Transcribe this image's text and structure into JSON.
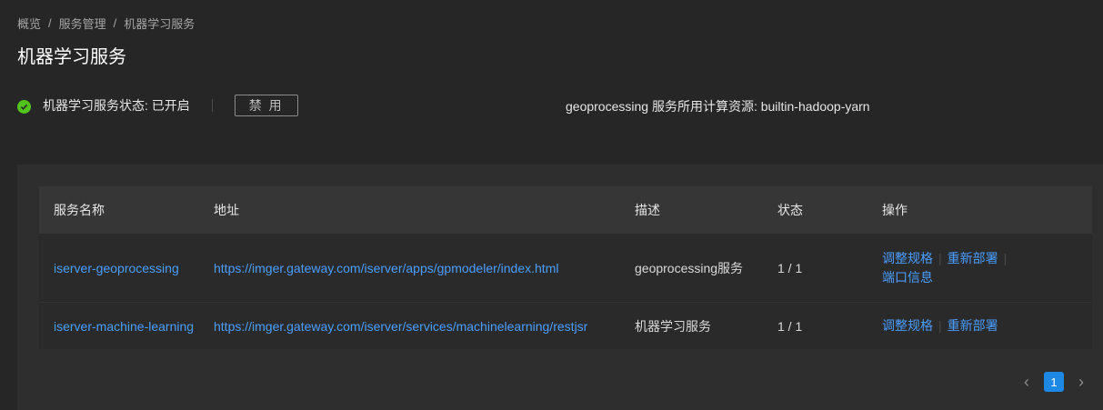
{
  "breadcrumb": {
    "items": [
      "概览",
      "服务管理",
      "机器学习服务"
    ],
    "separator": "/"
  },
  "page": {
    "title": "机器学习服务"
  },
  "status": {
    "text": "机器学习服务状态: 已开启",
    "icon": "check-circle-icon",
    "icon_color": "#52c41a",
    "disable_button": "禁 用",
    "compute_resource": "geoprocessing 服务所用计算资源: builtin-hadoop-yarn"
  },
  "table": {
    "columns": [
      "服务名称",
      "地址",
      "描述",
      "状态",
      "操作"
    ],
    "rows": [
      {
        "name": "iserver-geoprocessing",
        "address": "https://imger.gateway.com/iserver/apps/gpmodeler/index.html",
        "description": "geoprocessing服务",
        "status": "1 / 1",
        "actions": [
          "调整规格",
          "重新部署",
          "端口信息"
        ]
      },
      {
        "name": "iserver-machine-learning",
        "address": "https://imger.gateway.com/iserver/services/machinelearning/restjsr",
        "description": "机器学习服务",
        "status": "1 / 1",
        "actions": [
          "调整规格",
          "重新部署"
        ]
      }
    ]
  },
  "pagination": {
    "current": "1",
    "prev_icon": "chevron-left-icon",
    "next_icon": "chevron-right-icon"
  },
  "colors": {
    "link": "#4a9eff",
    "accent": "#1e88e5",
    "background": "#262626"
  }
}
